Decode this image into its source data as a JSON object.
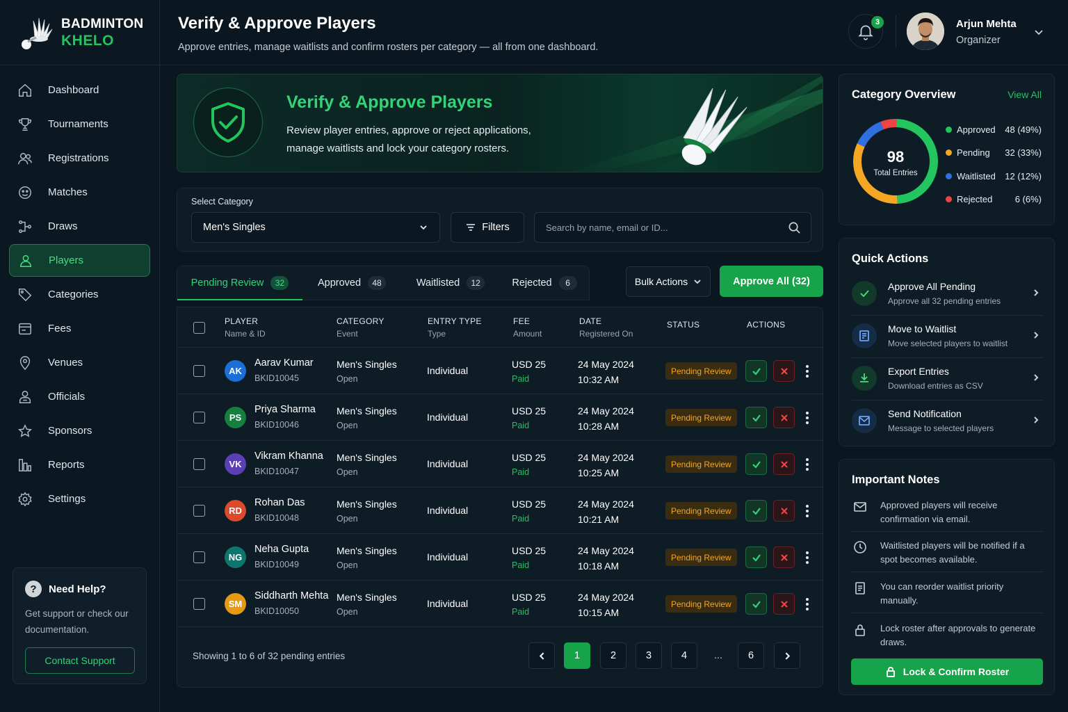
{
  "brand": {
    "line1": "BADMINTON",
    "line2": "KHELO"
  },
  "sidebar": {
    "items": [
      {
        "label": "Dashboard",
        "icon": "home-icon"
      },
      {
        "label": "Tournaments",
        "icon": "trophy-icon"
      },
      {
        "label": "Registrations",
        "icon": "users-icon"
      },
      {
        "label": "Matches",
        "icon": "shuttle-icon"
      },
      {
        "label": "Draws",
        "icon": "bracket-icon"
      },
      {
        "label": "Players",
        "icon": "user-icon",
        "active": true
      },
      {
        "label": "Categories",
        "icon": "tag-icon"
      },
      {
        "label": "Fees",
        "icon": "wallet-icon"
      },
      {
        "label": "Venues",
        "icon": "location-icon"
      },
      {
        "label": "Officials",
        "icon": "official-icon"
      },
      {
        "label": "Sponsors",
        "icon": "star-icon"
      },
      {
        "label": "Reports",
        "icon": "chart-icon"
      },
      {
        "label": "Settings",
        "icon": "gear-icon"
      }
    ],
    "help": {
      "title": "Need Help?",
      "text": "Get support or check our documentation.",
      "button": "Contact Support"
    }
  },
  "header": {
    "title": "Verify & Approve Players",
    "subtitle": "Approve entries, manage waitlists and confirm rosters per category — all from one dashboard.",
    "notifications": "3",
    "user_name": "Arjun Mehta",
    "user_role": "Organizer"
  },
  "hero": {
    "title": "Verify & Approve Players",
    "text": "Review player entries, approve or reject applications, manage waitlists and lock your category rosters."
  },
  "filters": {
    "label": "Select Category",
    "selected": "Men's Singles",
    "filters_button": "Filters",
    "search_placeholder": "Search by name, email or ID..."
  },
  "tabs": [
    {
      "label": "Pending Review",
      "count": "32",
      "active": true
    },
    {
      "label": "Approved",
      "count": "48"
    },
    {
      "label": "Waitlisted",
      "count": "12"
    },
    {
      "label": "Rejected",
      "count": "6"
    }
  ],
  "toolbar": {
    "bulk": "Bulk Actions",
    "approve_all": "Approve All (32)"
  },
  "table": {
    "columns": [
      {
        "title": "PLAYER",
        "sub": "Name & ID"
      },
      {
        "title": "CATEGORY",
        "sub": "Event"
      },
      {
        "title": "ENTRY TYPE",
        "sub": "Type"
      },
      {
        "title": "FEE",
        "sub": "Amount"
      },
      {
        "title": "DATE",
        "sub": "Registered On"
      },
      {
        "title": "STATUS",
        "sub": ""
      },
      {
        "title": "ACTIONS",
        "sub": ""
      }
    ],
    "rows": [
      {
        "initials": "AK",
        "color": "#1d6fd8",
        "name": "Aarav Kumar",
        "id": "BKID10045",
        "category": "Men's Singles",
        "event": "Open",
        "type": "Individual",
        "fee": "USD 25",
        "paid": "Paid",
        "date": "24 May 2024",
        "time": "10:32 AM",
        "status": "Pending Review"
      },
      {
        "initials": "PS",
        "color": "#15803d",
        "name": "Priya Sharma",
        "id": "BKID10046",
        "category": "Men's Singles",
        "event": "Open",
        "type": "Individual",
        "fee": "USD 25",
        "paid": "Paid",
        "date": "24 May 2024",
        "time": "10:28 AM",
        "status": "Pending Review"
      },
      {
        "initials": "VK",
        "color": "#5b3fb5",
        "name": "Vikram Khanna",
        "id": "BKID10047",
        "category": "Men's Singles",
        "event": "Open",
        "type": "Individual",
        "fee": "USD 25",
        "paid": "Paid",
        "date": "24 May 2024",
        "time": "10:25 AM",
        "status": "Pending Review"
      },
      {
        "initials": "RD",
        "color": "#dc4a2a",
        "name": "Rohan Das",
        "id": "BKID10048",
        "category": "Men's Singles",
        "event": "Open",
        "type": "Individual",
        "fee": "USD 25",
        "paid": "Paid",
        "date": "24 May 2024",
        "time": "10:21 AM",
        "status": "Pending Review"
      },
      {
        "initials": "NG",
        "color": "#0f766e",
        "name": "Neha Gupta",
        "id": "BKID10049",
        "category": "Men's Singles",
        "event": "Open",
        "type": "Individual",
        "fee": "USD 25",
        "paid": "Paid",
        "date": "24 May 2024",
        "time": "10:18 AM",
        "status": "Pending Review"
      },
      {
        "initials": "SM",
        "color": "#e69a12",
        "name": "Siddharth Mehta",
        "id": "BKID10050",
        "category": "Men's Singles",
        "event": "Open",
        "type": "Individual",
        "fee": "USD 25",
        "paid": "Paid",
        "date": "24 May 2024",
        "time": "10:15 AM",
        "status": "Pending Review"
      }
    ],
    "footer": "Showing 1 to 6 of 32 pending entries",
    "pages": [
      "1",
      "2",
      "3",
      "4",
      "...",
      "6"
    ]
  },
  "overview": {
    "title": "Category Overview",
    "view_all": "View All",
    "total": "98",
    "total_label": "Total Entries",
    "legend": [
      {
        "label": "Approved",
        "value": "48 (49%)",
        "color": "#22c55e",
        "count": 48
      },
      {
        "label": "Pending",
        "value": "32 (33%)",
        "color": "#f5a623",
        "count": 32
      },
      {
        "label": "Waitlisted",
        "value": "12 (12%)",
        "color": "#2f6fe0",
        "count": 12
      },
      {
        "label": "Rejected",
        "value": "6 (6%)",
        "color": "#ef4444",
        "count": 6
      }
    ]
  },
  "quick_actions": {
    "title": "Quick Actions",
    "items": [
      {
        "title": "Approve All Pending",
        "sub": "Approve all 32 pending entries",
        "icon": "check-circle-icon"
      },
      {
        "title": "Move to Waitlist",
        "sub": "Move selected players to waitlist",
        "icon": "list-icon"
      },
      {
        "title": "Export Entries",
        "sub": "Download entries as CSV",
        "icon": "download-icon"
      },
      {
        "title": "Send Notification",
        "sub": "Message to selected players",
        "icon": "message-icon"
      }
    ]
  },
  "notes": {
    "title": "Important Notes",
    "items": [
      {
        "text": "Approved players will receive confirmation via email.",
        "icon": "mail-icon"
      },
      {
        "text": "Waitlisted players will be notified if a spot becomes available.",
        "icon": "clock-icon"
      },
      {
        "text": "You can reorder waitlist priority manually.",
        "icon": "document-icon"
      },
      {
        "text": "Lock roster after approvals to generate draws.",
        "icon": "lock-icon"
      }
    ],
    "button": "Lock & Confirm Roster"
  }
}
